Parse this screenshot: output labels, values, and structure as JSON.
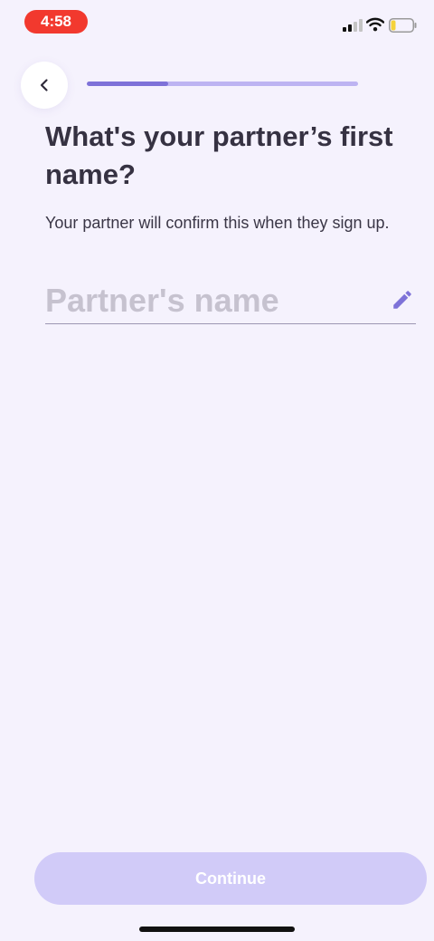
{
  "status_bar": {
    "time": "4:58",
    "icons": [
      "signal-icon",
      "wifi-icon",
      "battery-icon"
    ]
  },
  "header": {
    "back_icon": "chevron-left-icon",
    "progress": 0.3
  },
  "content": {
    "title": "What's your partner’s first name?",
    "subtitle": "Your partner will confirm this when they sign up.",
    "name_field": {
      "value": "",
      "placeholder": "Partner's name",
      "icon": "pencil-icon"
    }
  },
  "footer": {
    "continue_label": "Continue"
  },
  "colors": {
    "background": "#f5f2fd",
    "accent": "#7e72d8",
    "progress_track": "#bdb4f2",
    "button_disabled": "#d1cbf8",
    "time_pill": "#f2392e"
  }
}
